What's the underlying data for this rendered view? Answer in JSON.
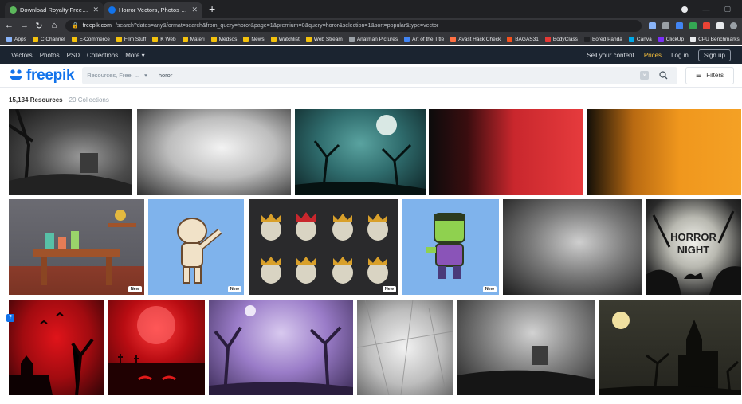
{
  "browser": {
    "tabs": [
      {
        "title": "Download Royalty Free Sound E",
        "active": false
      },
      {
        "title": "Horror Vectors, Photos and PSD",
        "active": true
      }
    ],
    "url_domain": "freepik.com",
    "url_path": "/search?dates=any&format=search&from_query=horor&page=1&premium=0&query=horor&selection=1&sort=popular&type=vector",
    "bookmarks": [
      "Apps",
      "C Channel",
      "E-Commerce",
      "Film Stuff",
      "K Web",
      "Materi",
      "Medsos",
      "News",
      "Watchlist",
      "Web Stream",
      "Anatman Pictures",
      "Art of the Title",
      "Avast Hack Check",
      "BAGAS31",
      "BodyClass",
      "Bored Panda",
      "Canva",
      "ClickUp",
      "CPU Benchmarks"
    ]
  },
  "fpnav": {
    "items": [
      "Vectors",
      "Photos",
      "PSD",
      "Collections",
      "More"
    ],
    "sell": "Sell your content",
    "prices": "Prices",
    "login": "Log in",
    "signup": "Sign up"
  },
  "search": {
    "logo": "freepik",
    "scope": "Resources, Free, ...",
    "query": "horor",
    "filters": "Filters"
  },
  "results": {
    "count": "15,134 Resources",
    "collections": "20 Collections",
    "new_badge": "New",
    "horror_title_1": "HORROR",
    "horror_title_2": "NIGHT"
  },
  "colors": {
    "brand": "#1273eb",
    "nav_bg": "#1b2430",
    "prices": "#f9c23c"
  }
}
